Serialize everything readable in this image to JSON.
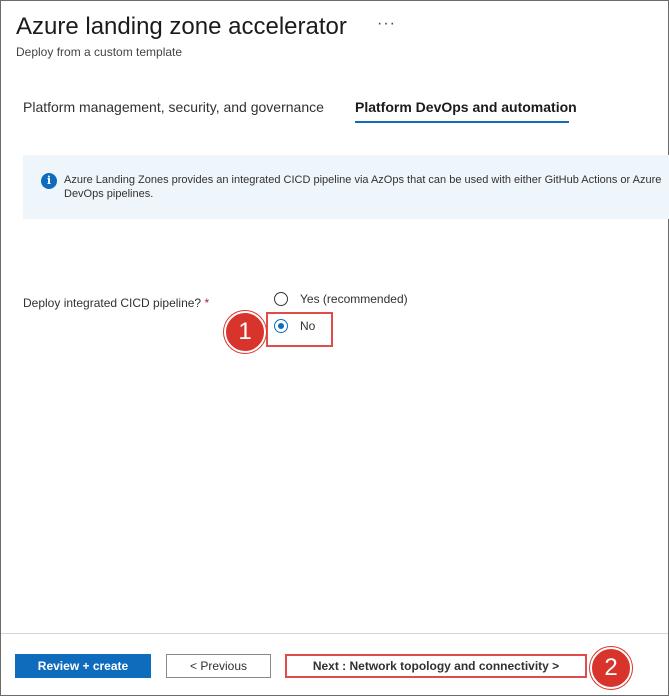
{
  "header": {
    "title": "Azure landing zone accelerator",
    "more_label": "···",
    "subtitle": "Deploy from a custom template"
  },
  "tabs": [
    {
      "label": "Platform management, security, and governance",
      "selected": false
    },
    {
      "label": "Platform DevOps and automation",
      "selected": true
    }
  ],
  "info_banner": {
    "icon": "info-icon",
    "glyph": "i",
    "text": "Azure Landing Zones provides an integrated CICD pipeline via AzOps that can be used with either GitHub Actions or Azure DevOps pipelines."
  },
  "form": {
    "cicd_label": "Deploy integrated CICD pipeline?",
    "required_mark": "*",
    "options": [
      {
        "label": "Yes (recommended)",
        "checked": false
      },
      {
        "label": "No",
        "checked": true
      }
    ]
  },
  "annotations": {
    "badge1": "1",
    "badge2": "2",
    "color": "#d9342b"
  },
  "footer": {
    "review_create": "Review + create",
    "previous": "< Previous",
    "next": "Next : Network topology and connectivity >"
  },
  "colors": {
    "accent": "#0f6cbd",
    "info_bg": "#eef6fc",
    "highlight": "#e04b4b"
  }
}
